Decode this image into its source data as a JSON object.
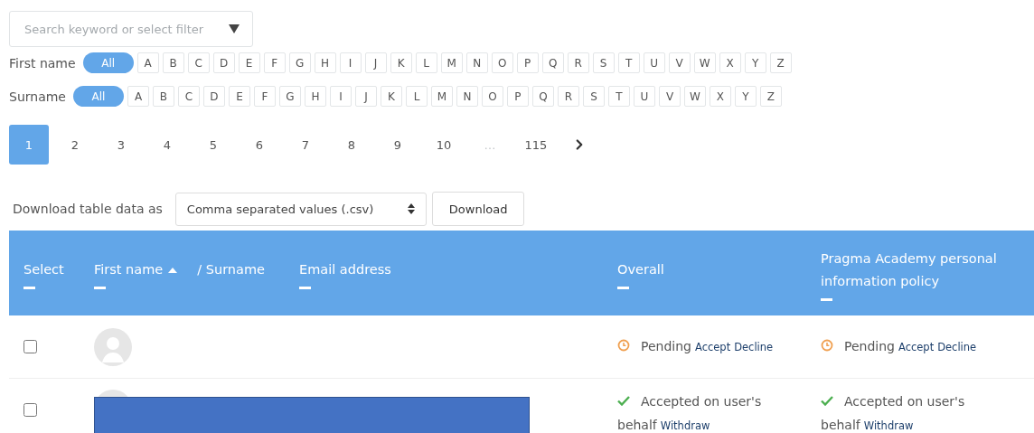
{
  "search": {
    "placeholder": "Search keyword or select filter"
  },
  "initial_filters": [
    {
      "label": "First name",
      "options": [
        {
          "label": "All",
          "selected": true
        },
        {
          "label": "A",
          "selected": false
        },
        {
          "label": "B",
          "selected": false
        },
        {
          "label": "C",
          "selected": false
        },
        {
          "label": "D",
          "selected": false
        },
        {
          "label": "E",
          "selected": false
        },
        {
          "label": "F",
          "selected": false
        },
        {
          "label": "G",
          "selected": false
        },
        {
          "label": "H",
          "selected": false
        },
        {
          "label": "I",
          "selected": false
        },
        {
          "label": "J",
          "selected": false
        },
        {
          "label": "K",
          "selected": false
        },
        {
          "label": "L",
          "selected": false
        },
        {
          "label": "M",
          "selected": false
        },
        {
          "label": "N",
          "selected": false
        },
        {
          "label": "O",
          "selected": false
        },
        {
          "label": "P",
          "selected": false
        },
        {
          "label": "Q",
          "selected": false
        },
        {
          "label": "R",
          "selected": false
        },
        {
          "label": "S",
          "selected": false
        },
        {
          "label": "T",
          "selected": false
        },
        {
          "label": "U",
          "selected": false
        },
        {
          "label": "V",
          "selected": false
        },
        {
          "label": "W",
          "selected": false
        },
        {
          "label": "X",
          "selected": false
        },
        {
          "label": "Y",
          "selected": false
        },
        {
          "label": "Z",
          "selected": false
        }
      ]
    },
    {
      "label": "Surname",
      "options": [
        {
          "label": "All",
          "selected": true
        },
        {
          "label": "A",
          "selected": false
        },
        {
          "label": "B",
          "selected": false
        },
        {
          "label": "C",
          "selected": false
        },
        {
          "label": "D",
          "selected": false
        },
        {
          "label": "E",
          "selected": false
        },
        {
          "label": "F",
          "selected": false
        },
        {
          "label": "G",
          "selected": false
        },
        {
          "label": "H",
          "selected": false
        },
        {
          "label": "I",
          "selected": false
        },
        {
          "label": "J",
          "selected": false
        },
        {
          "label": "K",
          "selected": false
        },
        {
          "label": "L",
          "selected": false
        },
        {
          "label": "M",
          "selected": false
        },
        {
          "label": "N",
          "selected": false
        },
        {
          "label": "O",
          "selected": false
        },
        {
          "label": "P",
          "selected": false
        },
        {
          "label": "Q",
          "selected": false
        },
        {
          "label": "R",
          "selected": false
        },
        {
          "label": "S",
          "selected": false
        },
        {
          "label": "T",
          "selected": false
        },
        {
          "label": "U",
          "selected": false
        },
        {
          "label": "V",
          "selected": false
        },
        {
          "label": "W",
          "selected": false
        },
        {
          "label": "X",
          "selected": false
        },
        {
          "label": "Y",
          "selected": false
        },
        {
          "label": "Z",
          "selected": false
        }
      ]
    }
  ],
  "pagination": [
    {
      "label": "1",
      "selected": true,
      "disabled": false
    },
    {
      "label": "2",
      "selected": false,
      "disabled": false
    },
    {
      "label": "3",
      "selected": false,
      "disabled": false
    },
    {
      "label": "4",
      "selected": false,
      "disabled": false
    },
    {
      "label": "5",
      "selected": false,
      "disabled": false
    },
    {
      "label": "6",
      "selected": false,
      "disabled": false
    },
    {
      "label": "7",
      "selected": false,
      "disabled": false
    },
    {
      "label": "8",
      "selected": false,
      "disabled": false
    },
    {
      "label": "9",
      "selected": false,
      "disabled": false
    },
    {
      "label": "10",
      "selected": false,
      "disabled": false
    },
    {
      "label": "…",
      "selected": false,
      "disabled": true
    },
    {
      "label": "115",
      "selected": false,
      "disabled": false
    }
  ],
  "download": {
    "label": "Download table data as",
    "format": "Comma separated values (.csv)",
    "button": "Download"
  },
  "table": {
    "columns": [
      {
        "label": "Select"
      },
      {
        "label": "First name",
        "sort_suffix": "/ Surname"
      },
      {
        "label": "Email address"
      },
      {
        "label": "Overall"
      },
      {
        "label": "Pragma Academy personal information policy"
      }
    ],
    "rows": [
      {
        "checked": false,
        "redacted": false,
        "overall": {
          "kind": "pending",
          "text": "Pending",
          "actions": [
            "Accept",
            "Decline"
          ]
        },
        "policy": {
          "kind": "pending",
          "text": "Pending",
          "actions": [
            "Accept",
            "Decline"
          ]
        }
      },
      {
        "checked": false,
        "redacted": true,
        "overall": {
          "kind": "accepted",
          "text": "Accepted on user's behalf",
          "actions": [
            "Withdraw"
          ]
        },
        "policy": {
          "kind": "accepted",
          "text": "Accepted on user's behalf",
          "actions": [
            "Withdraw"
          ]
        }
      }
    ]
  }
}
